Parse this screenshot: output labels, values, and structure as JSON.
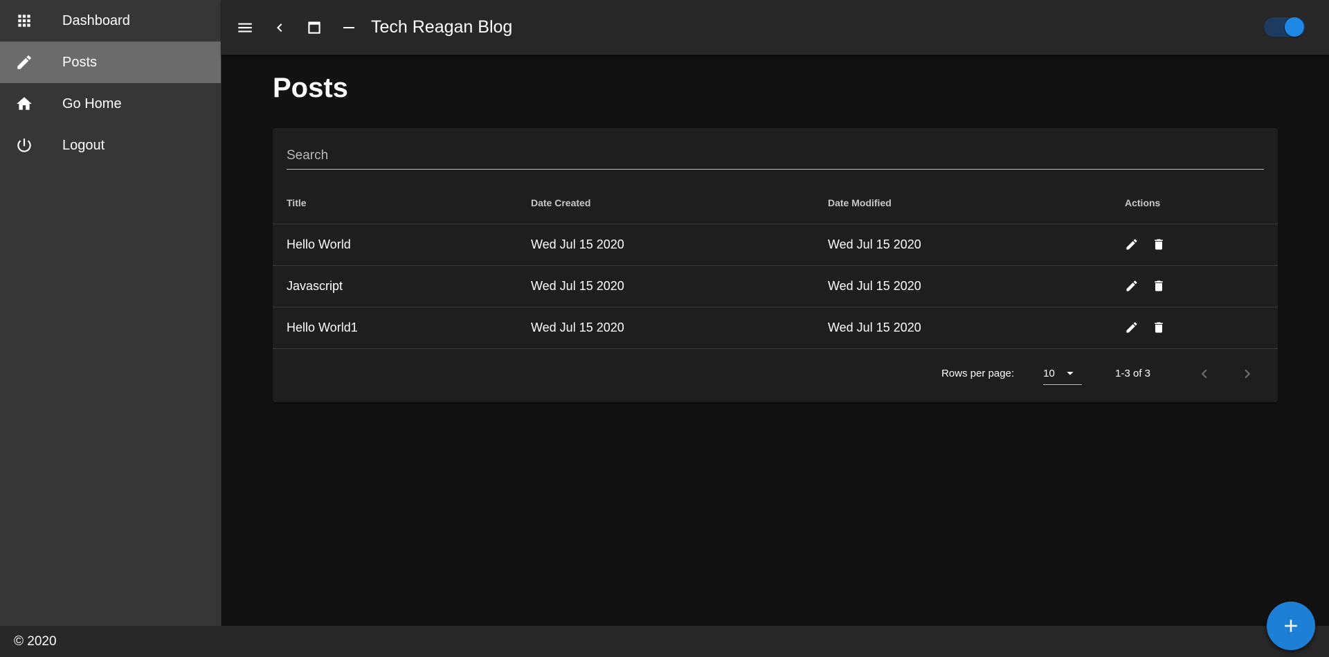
{
  "app": {
    "title": "Tech Reagan Blog",
    "theme_toggle_on": true
  },
  "sidebar": {
    "items": [
      {
        "label": "Dashboard",
        "icon": "apps-grid-icon",
        "active": false
      },
      {
        "label": "Posts",
        "icon": "pencil-icon",
        "active": true
      },
      {
        "label": "Go Home",
        "icon": "home-icon",
        "active": false
      },
      {
        "label": "Logout",
        "icon": "power-icon",
        "active": false
      }
    ]
  },
  "page": {
    "title": "Posts"
  },
  "search": {
    "placeholder": "Search",
    "value": ""
  },
  "table": {
    "headers": [
      "Title",
      "Date Created",
      "Date Modified",
      "Actions"
    ],
    "rows": [
      {
        "title": "Hello World",
        "created": "Wed Jul 15 2020",
        "modified": "Wed Jul 15 2020"
      },
      {
        "title": "Javascript",
        "created": "Wed Jul 15 2020",
        "modified": "Wed Jul 15 2020"
      },
      {
        "title": "Hello World1",
        "created": "Wed Jul 15 2020",
        "modified": "Wed Jul 15 2020"
      }
    ]
  },
  "pagination": {
    "rows_per_page_label": "Rows per page:",
    "rows_per_page": "10",
    "range": "1-3 of 3"
  },
  "footer": {
    "text": "© 2020"
  },
  "colors": {
    "accent": "#1e88e5",
    "sidebar_bg": "#363636",
    "appbar_bg": "#272727",
    "page_bg": "#121212",
    "card_bg": "#1e1e1e"
  }
}
